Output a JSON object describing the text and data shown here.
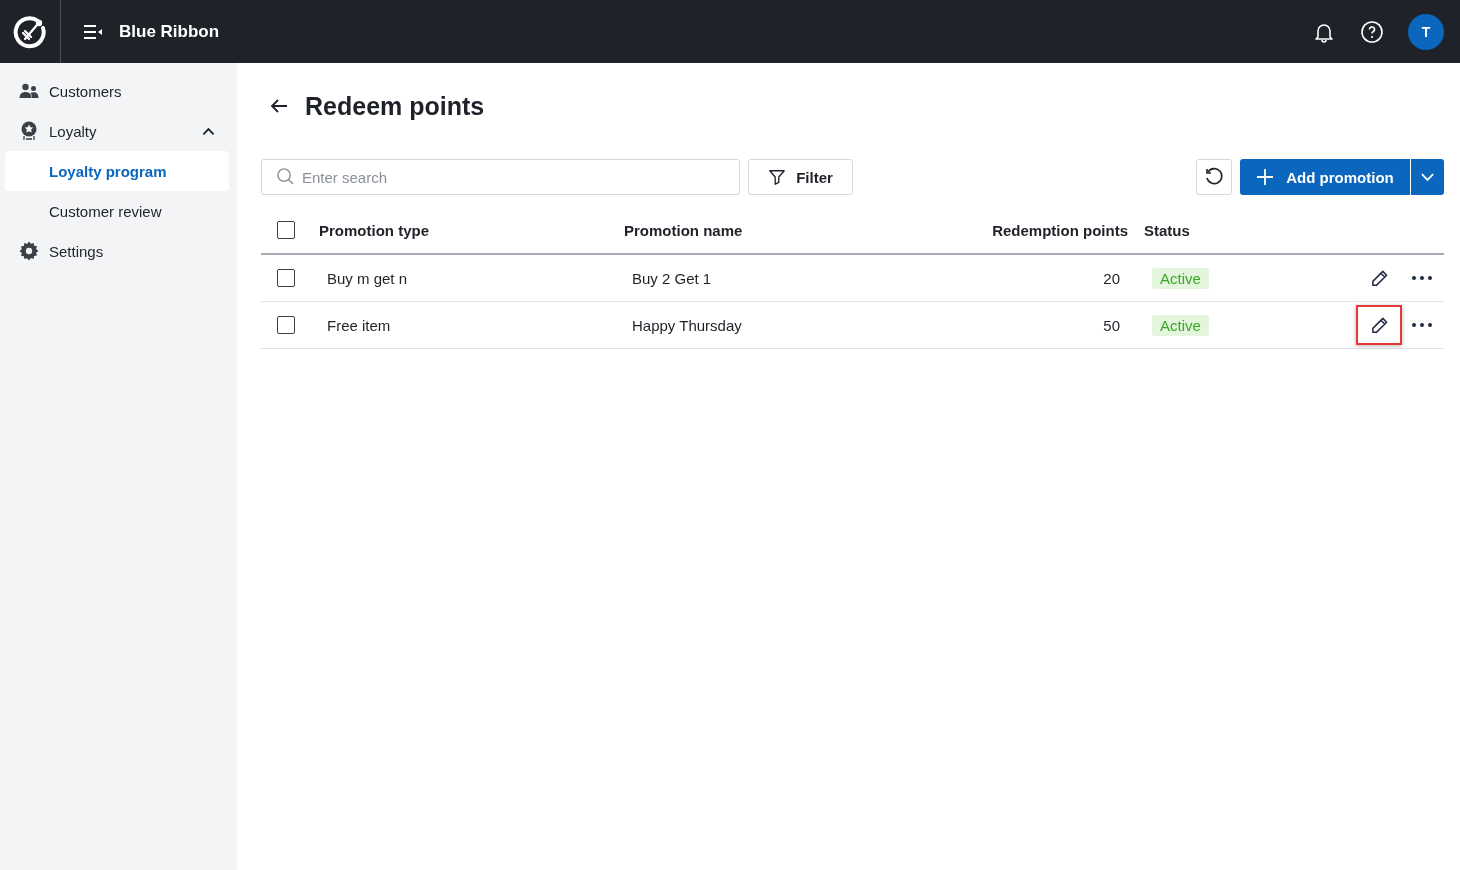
{
  "header": {
    "app_name": "Blue Ribbon",
    "avatar_initial": "T"
  },
  "sidebar": {
    "items": [
      {
        "label": "Customers",
        "selected": false
      },
      {
        "label": "Loyalty",
        "selected": false,
        "expanded": true,
        "children": [
          {
            "label": "Loyalty program",
            "selected": true
          },
          {
            "label": "Customer review",
            "selected": false
          }
        ]
      },
      {
        "label": "Settings",
        "selected": false
      }
    ]
  },
  "page": {
    "title": "Redeem points"
  },
  "toolbar": {
    "search": {
      "placeholder": "Enter search"
    },
    "filter_label": "Filter",
    "add_label": "Add promotion"
  },
  "table": {
    "columns": [
      "Promotion type",
      "Promotion name",
      "Redemption points",
      "Status"
    ],
    "all_checked": false,
    "rows": [
      {
        "type": "Buy m get n",
        "name": "Buy 2 Get 1",
        "points": "20",
        "status": "Active",
        "checked": false,
        "highlighted": false
      },
      {
        "type": "Free item",
        "name": "Happy Thursday",
        "points": "50",
        "status": "Active",
        "checked": false,
        "highlighted": true
      }
    ]
  }
}
